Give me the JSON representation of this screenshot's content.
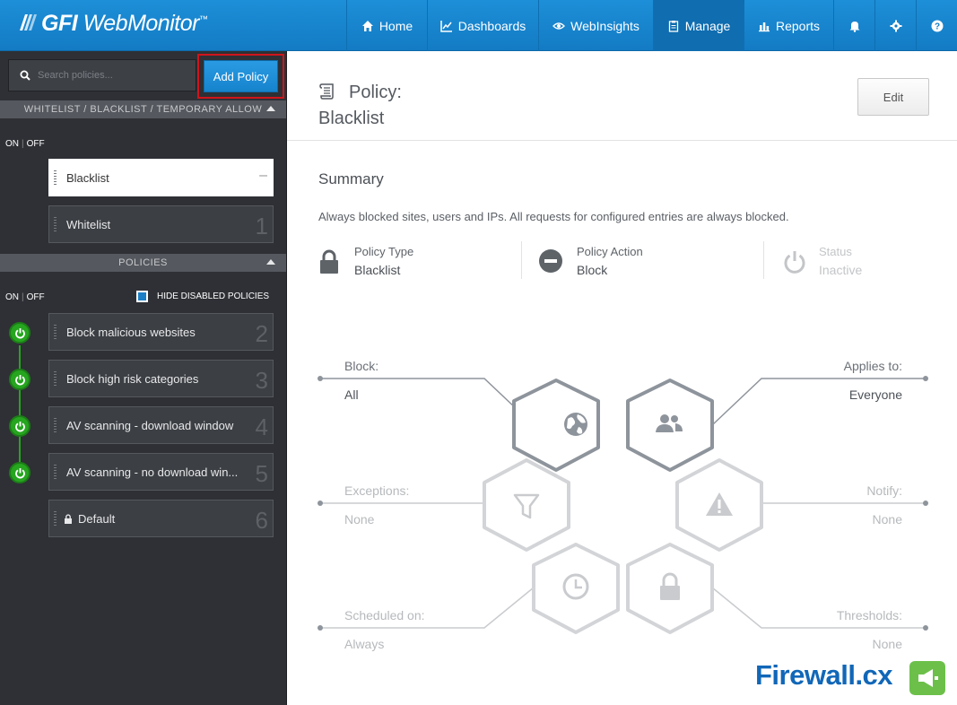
{
  "app": {
    "logo_part1": "GFI",
    "logo_part2": "WebMonitor",
    "logo_tm": "™"
  },
  "nav": {
    "home": "Home",
    "dashboards": "Dashboards",
    "webinsights": "WebInsights",
    "manage": "Manage",
    "reports": "Reports"
  },
  "sidebar": {
    "search_placeholder": "Search policies...",
    "add_policy": "Add Policy",
    "section1_title": "WHITELIST / BLACKLIST / TEMPORARY ALLOW",
    "on": "ON",
    "off": "OFF",
    "sep": "|",
    "lists": [
      {
        "name": "Blacklist",
        "num": "–"
      },
      {
        "name": "Whitelist",
        "num": "1"
      }
    ],
    "section2_title": "POLICIES",
    "hide_disabled": "HIDE DISABLED POLICIES",
    "policies": [
      {
        "name": "Block malicious websites",
        "num": "2"
      },
      {
        "name": "Block high risk categories",
        "num": "3"
      },
      {
        "name": "AV scanning - download window",
        "num": "4"
      },
      {
        "name": "AV scanning - no download win...",
        "num": "5"
      },
      {
        "name": "Default",
        "num": "6"
      }
    ]
  },
  "main": {
    "policy_label": "Policy:",
    "policy_name": "Blacklist",
    "edit": "Edit",
    "summary_title": "Summary",
    "summary_desc": "Always blocked sites, users and IPs. All requests for configured entries are always blocked.",
    "policy_type_label": "Policy Type",
    "policy_type_value": "Blacklist",
    "policy_action_label": "Policy Action",
    "policy_action_value": "Block",
    "status_label": "Status",
    "status_value": "Inactive",
    "block_label": "Block:",
    "block_value": "All",
    "applies_label": "Applies to:",
    "applies_value": "Everyone",
    "exceptions_label": "Exceptions:",
    "exceptions_value": "None",
    "notify_label": "Notify:",
    "notify_value": "None",
    "scheduled_label": "Scheduled on:",
    "scheduled_value": "Always",
    "thresholds_label": "Thresholds:",
    "thresholds_value": "None"
  },
  "watermark": {
    "text": "Firewall",
    "suffix": ".cx"
  }
}
